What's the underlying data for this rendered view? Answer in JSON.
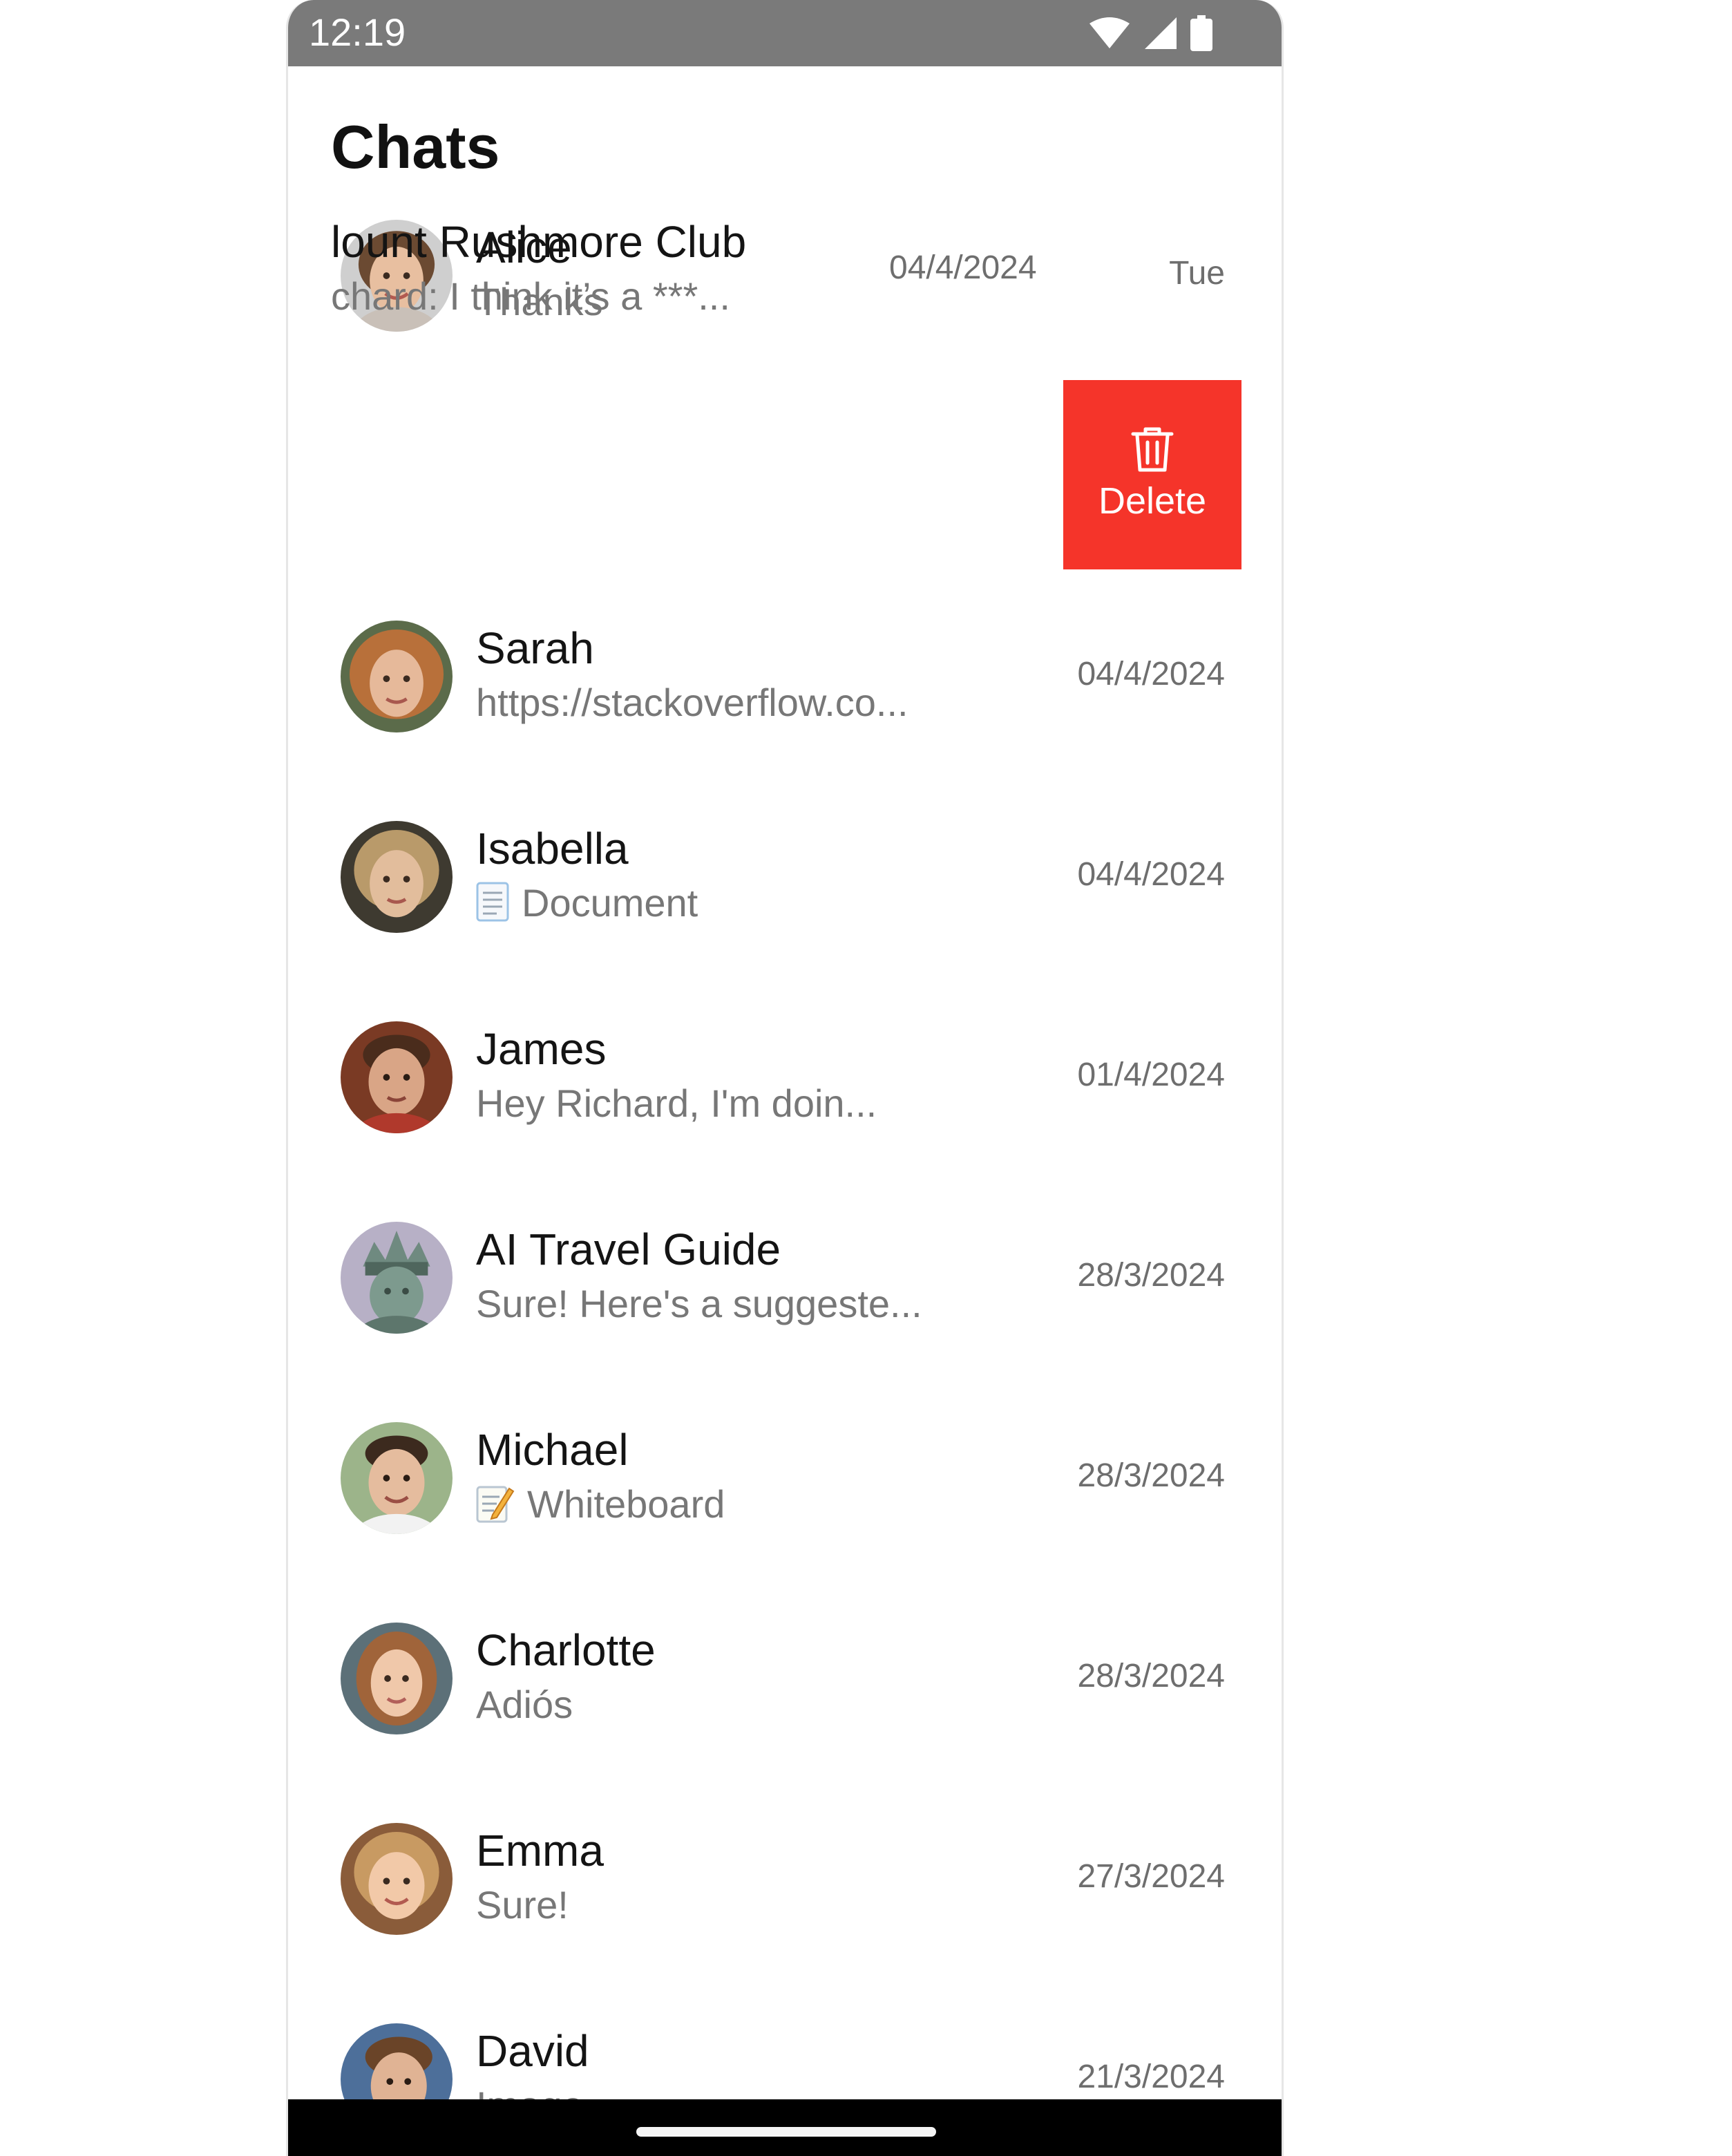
{
  "status_bar": {
    "time": "12:19",
    "icons": [
      "wifi-icon",
      "cell-signal-icon",
      "battery-icon"
    ]
  },
  "title": "Chats",
  "colors": {
    "delete_bg": "#f5342a",
    "status_bar_bg": "#7a7a7a",
    "name_text": "#141414",
    "preview_text": "#777777",
    "date_text": "#6e6e6e"
  },
  "chats": [
    {
      "name": "Alice",
      "preview": "Thanks",
      "date": "Tue",
      "avatar": "avatar-alice"
    },
    {
      "name": "Sarah",
      "preview": "https://stackoverflow.co...",
      "date": "04/4/2024",
      "avatar": "avatar-sarah"
    },
    {
      "name": "Isabella",
      "preview": "Document",
      "preview_icon": "document-icon",
      "date": "04/4/2024",
      "avatar": "avatar-isabella"
    },
    {
      "name": "James",
      "preview": "Hey Richard, I'm doin...",
      "date": "01/4/2024",
      "avatar": "avatar-james"
    },
    {
      "name": "AI Travel Guide",
      "preview": "Sure! Here's a suggeste...",
      "date": "28/3/2024",
      "avatar": "avatar-statue-of-liberty"
    },
    {
      "name": "Michael",
      "preview": "Whiteboard",
      "preview_icon": "memo-icon",
      "date": "28/3/2024",
      "avatar": "avatar-michael"
    },
    {
      "name": "Charlotte",
      "preview": "Adiós",
      "date": "28/3/2024",
      "avatar": "avatar-charlotte"
    },
    {
      "name": "Emma",
      "preview": "Sure!",
      "date": "27/3/2024",
      "avatar": "avatar-emma"
    },
    {
      "name": "David",
      "preview": "Image",
      "date": "21/3/2024",
      "avatar": "avatar-david"
    }
  ],
  "swiped_chat": {
    "name": "lount Rushmore Club",
    "preview": "chard: I think it’s a ***...",
    "date": "04/4/2024",
    "action": {
      "label": "Delete",
      "icon": "trash-icon"
    }
  }
}
